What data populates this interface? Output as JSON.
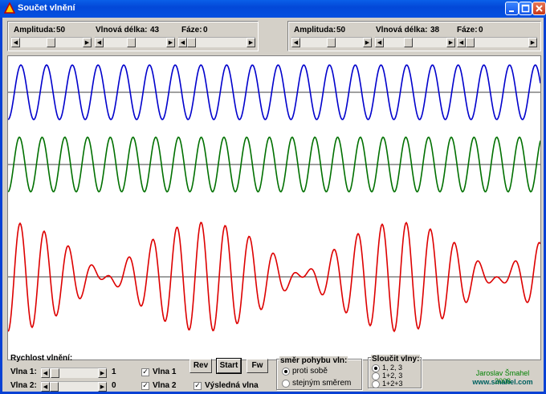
{
  "window": {
    "title": "Součet vlnění"
  },
  "wave1": {
    "amplitude_label": "Amplituda:",
    "amplitude_value": "50",
    "wavelength_label": "Vlnová délka:",
    "wavelength_value": "43",
    "phase_label": "Fáze:",
    "phase_value": "0",
    "amplitude_pos": 0.5,
    "wavelength_pos": 0.45,
    "phase_pos": 0.0
  },
  "wave2": {
    "amplitude_label": "Amplituda:",
    "amplitude_value": "50",
    "wavelength_label": "Vlnová délka:",
    "wavelength_value": "38",
    "phase_label": "Fáze:",
    "phase_value": "0",
    "amplitude_pos": 0.5,
    "wavelength_pos": 0.4,
    "phase_pos": 0.0
  },
  "speed": {
    "heading": "Rychlost vlnění:",
    "wave1_label": "Vlna 1:",
    "wave1_value": "1",
    "wave2_label": "Vlna 2:",
    "wave2_value": "0",
    "wave1_pos": 0.02,
    "wave2_pos": 0.0
  },
  "checks": {
    "wave1": "Vlna 1",
    "wave2": "Vlna 2",
    "result": "Výsledná vlna"
  },
  "buttons": {
    "rev": "Rev",
    "start": "Start",
    "fw": "Fw"
  },
  "direction": {
    "heading": "směr pohybu vln:",
    "opt_opposite": "proti sobě",
    "opt_same": "stejným směrem",
    "selected": "proti sobě"
  },
  "merge": {
    "heading": "Sloučit vlny:",
    "opt1": "1, 2, 3",
    "opt2": "1+2, 3",
    "opt3": "1+2+3",
    "selected": "1, 2, 3"
  },
  "credit": {
    "author": "Jaroslav Šmahel 2008",
    "url": "www.smahel.com"
  },
  "colors": {
    "wave1": "#0000cc",
    "wave2": "#007000",
    "result": "#dd0000",
    "axis": "#404040"
  }
}
